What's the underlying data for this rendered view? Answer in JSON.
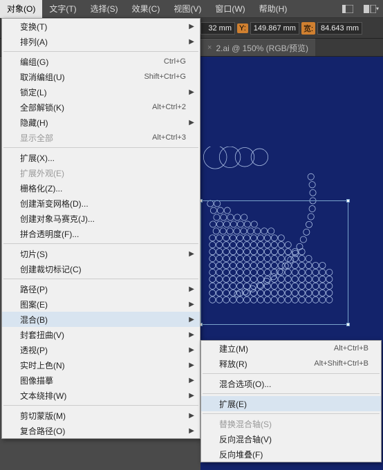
{
  "menubar": {
    "items": [
      "对象(O)",
      "文字(T)",
      "选择(S)",
      "效果(C)",
      "视图(V)",
      "窗口(W)",
      "帮助(H)"
    ]
  },
  "toolbar": {
    "x_suffix": "32 mm",
    "y_label": "Y:",
    "y_value": "149.867 mm",
    "w_label": "宽:",
    "w_value": "84.643 mm"
  },
  "tab": {
    "title": "2.ai @ 150% (RGB/预览)",
    "close": "×"
  },
  "menu1": [
    {
      "t": "row",
      "lbl": "变换(T)",
      "arrow": true
    },
    {
      "t": "row",
      "lbl": "排列(A)",
      "arrow": true
    },
    {
      "t": "sep"
    },
    {
      "t": "row",
      "lbl": "编组(G)",
      "sc": "Ctrl+G"
    },
    {
      "t": "row",
      "lbl": "取消编组(U)",
      "sc": "Shift+Ctrl+G"
    },
    {
      "t": "row",
      "lbl": "锁定(L)",
      "arrow": true
    },
    {
      "t": "row",
      "lbl": "全部解锁(K)",
      "sc": "Alt+Ctrl+2"
    },
    {
      "t": "row",
      "lbl": "隐藏(H)",
      "arrow": true
    },
    {
      "t": "row",
      "lbl": "显示全部",
      "sc": "Alt+Ctrl+3",
      "dis": true
    },
    {
      "t": "sep"
    },
    {
      "t": "row",
      "lbl": "扩展(X)..."
    },
    {
      "t": "row",
      "lbl": "扩展外观(E)",
      "dis": true
    },
    {
      "t": "row",
      "lbl": "栅格化(Z)..."
    },
    {
      "t": "row",
      "lbl": "创建渐变网格(D)..."
    },
    {
      "t": "row",
      "lbl": "创建对象马赛克(J)..."
    },
    {
      "t": "row",
      "lbl": "拼合透明度(F)..."
    },
    {
      "t": "sep"
    },
    {
      "t": "row",
      "lbl": "切片(S)",
      "arrow": true
    },
    {
      "t": "row",
      "lbl": "创建裁切标记(C)"
    },
    {
      "t": "sep"
    },
    {
      "t": "row",
      "lbl": "路径(P)",
      "arrow": true
    },
    {
      "t": "row",
      "lbl": "图案(E)",
      "arrow": true
    },
    {
      "t": "row",
      "lbl": "混合(B)",
      "arrow": true,
      "hov": true
    },
    {
      "t": "row",
      "lbl": "封套扭曲(V)",
      "arrow": true
    },
    {
      "t": "row",
      "lbl": "透视(P)",
      "arrow": true
    },
    {
      "t": "row",
      "lbl": "实时上色(N)",
      "arrow": true
    },
    {
      "t": "row",
      "lbl": "图像描摹",
      "arrow": true
    },
    {
      "t": "row",
      "lbl": "文本绕排(W)",
      "arrow": true
    },
    {
      "t": "sep"
    },
    {
      "t": "row",
      "lbl": "剪切蒙版(M)",
      "arrow": true
    },
    {
      "t": "row",
      "lbl": "复合路径(O)",
      "arrow": true
    }
  ],
  "menu2": [
    {
      "t": "row",
      "lbl": "建立(M)",
      "sc": "Alt+Ctrl+B"
    },
    {
      "t": "row",
      "lbl": "释放(R)",
      "sc": "Alt+Shift+Ctrl+B"
    },
    {
      "t": "sep"
    },
    {
      "t": "row",
      "lbl": "混合选项(O)..."
    },
    {
      "t": "sep"
    },
    {
      "t": "row",
      "lbl": "扩展(E)",
      "hov": true
    },
    {
      "t": "sep"
    },
    {
      "t": "row",
      "lbl": "替换混合轴(S)",
      "dis": true
    },
    {
      "t": "row",
      "lbl": "反向混合轴(V)"
    },
    {
      "t": "row",
      "lbl": "反向堆叠(F)"
    }
  ]
}
